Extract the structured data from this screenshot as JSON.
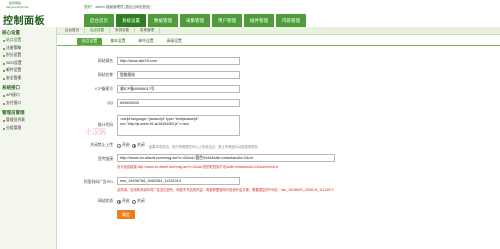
{
  "header": {
    "site_name": "技术网站",
    "site_url": "hanyuan123.com",
    "logo_title": "控制面板",
    "welcome_prefix": "您好！",
    "welcome_user": "admin",
    "welcome_suffix": "超级管理员 [退出] [网站首页]",
    "nav": [
      "后台首页",
      "系统设置",
      "数据管理",
      "采集管理",
      "用户管理",
      "插件管理",
      "内容管理"
    ],
    "active_nav_index": 1
  },
  "sidebar": {
    "groups": [
      {
        "title": "核心设置",
        "items": [
          "站点设置",
          "注册策略",
          "积分设置",
          "SEO设置",
          "邮件设置",
          "安全管理"
        ]
      },
      {
        "title": "系统接口",
        "items": [
          "API接口",
          "支付接口"
        ]
      },
      {
        "title": "管理员管理",
        "items": [
          "管理员列表",
          "分组管理"
        ]
      }
    ],
    "active_item": "站点设置"
  },
  "breadcrumb": [
    "后台首页",
    "站点设置",
    "系统设置",
    "菜单管理"
  ],
  "subtabs": [
    "站点设置",
    "基本设置",
    "邮件设置",
    "高级设置"
  ],
  "form": {
    "site_name_label": "网站域名",
    "site_name_value": "http://www.alia78.com",
    "site_title_label": "网站名称",
    "site_title_value": "智能图站",
    "icp_label": "ICP备案号",
    "icp_value": "湘ICP备09086017号",
    "qq_label": "QQ",
    "qq_value": "695693343",
    "stats_label": "统计代码",
    "stats_value": "<script language=\"javascript\" type=\"text/javascript\" src=\"http://js.users.51.la/16494463.js\"></scri",
    "watermark": "小汉网",
    "close_label": "关闭禁止上传",
    "close_options": [
      "开启",
      "关闭"
    ],
    "close_selected": 1,
    "close_hint": "如果本项关闭，则只有管理员可以上传到站点，禁止所有图片功能暂停服务",
    "url_label": "宣传链接",
    "url_value": "http://amos.im.alisoft.com/msg.aw?v=2&uid=管色3344&site=cntaobao&s=2&ch",
    "url_hint": "设计信息链接:http://amos.im.alisoft.com/msg.aw?v=2&uid=您的旺旺用户名&site=cntaobao&s=2&charset=utf-8",
    "ad_label": "阿里妈妈广告PID",
    "ad_value": "mm_34936756_3462454_11331014",
    "ad_hint": "必须填，否则有未填写时广告空位缺失。例如不开启的内容，淘宝联盟官网可查询开启方案，需要重复的PID如：mm_16108683_2398145_11214572",
    "status_label": "网站状态",
    "status_options": [
      "开启",
      "关闭"
    ],
    "status_selected": 0,
    "submit_label": "确定"
  },
  "colors": {
    "nav_green": "#4f9d3a",
    "nav_active": "#2f7f22",
    "hint_red": "#d12b2b",
    "submit_orange": "#ee7c1a"
  }
}
